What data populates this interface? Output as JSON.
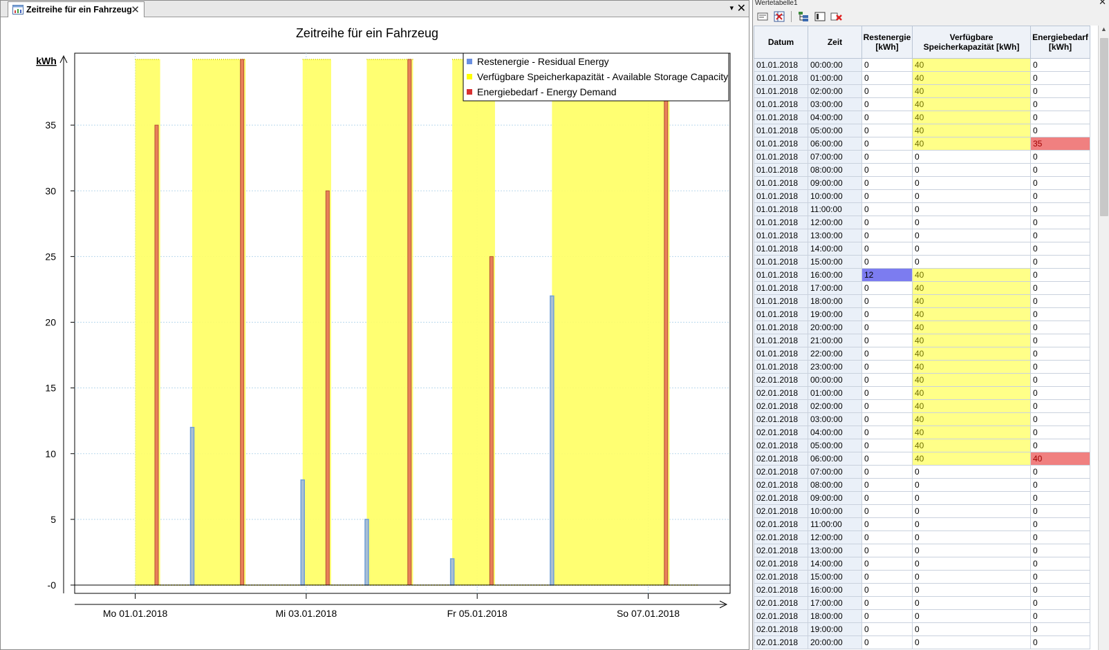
{
  "tab": {
    "label": "Zeitreihe für ein Fahrzeug",
    "close": "✕"
  },
  "pane_controls": {
    "menu": "▾",
    "close": "✕"
  },
  "right_panel": {
    "title": "Wertetabelle1",
    "close": "✕"
  },
  "toolbar_icons": [
    "table-properties-icon",
    "delete-table-icon",
    "export-tree-icon",
    "column-icon",
    "remove-icon"
  ],
  "colors": {
    "residual": "#6f9fd8",
    "storage": "#ffff66",
    "demand": "#e8805a",
    "legend_residual": "#6a8fe0",
    "legend_storage": "#ffff00",
    "legend_demand": "#d83030"
  },
  "chart_data": {
    "type": "bar",
    "title": "Zeitreihe für ein Fahrzeug",
    "ylabel": "kWh",
    "ylim": [
      0,
      40
    ],
    "yticks": [
      {
        "v": 0,
        "label": "-0"
      },
      {
        "v": 5,
        "label": "5"
      },
      {
        "v": 10,
        "label": "10"
      },
      {
        "v": 15,
        "label": "15"
      },
      {
        "v": 20,
        "label": "20"
      },
      {
        "v": 25,
        "label": "25"
      },
      {
        "v": 30,
        "label": "30"
      },
      {
        "v": 35,
        "label": "35"
      }
    ],
    "x_unit": "hours from 01.01.2018 00:00",
    "xlim": [
      -17,
      167
    ],
    "xticks": [
      {
        "v": 0,
        "label": "Mo 01.01.2018"
      },
      {
        "v": 48,
        "label": "Mi 03.01.2018"
      },
      {
        "v": 96,
        "label": "Fr 05.01.2018"
      },
      {
        "v": 144,
        "label": "So 07.01.2018"
      }
    ],
    "legend": [
      {
        "key": "residual",
        "label": "Restenergie - Residual Energy"
      },
      {
        "key": "storage",
        "label": "Verfügbare Speicherkapazität - Available Storage Capacity"
      },
      {
        "key": "demand",
        "label": "Energiebedarf - Energy Demand"
      }
    ],
    "storage_value": 40,
    "storage_ranges": [
      [
        0,
        7
      ],
      [
        16,
        31
      ],
      [
        47,
        55
      ],
      [
        65,
        78
      ],
      [
        89,
        101
      ],
      [
        117,
        150
      ]
    ],
    "residual": [
      {
        "x": 16,
        "y": 12
      },
      {
        "x": 47,
        "y": 8
      },
      {
        "x": 65,
        "y": 5
      },
      {
        "x": 89,
        "y": 2
      },
      {
        "x": 117,
        "y": 22
      }
    ],
    "demand": [
      {
        "x": 6,
        "y": 35
      },
      {
        "x": 30,
        "y": 40
      },
      {
        "x": 54,
        "y": 30
      },
      {
        "x": 77,
        "y": 40
      },
      {
        "x": 100,
        "y": 25
      },
      {
        "x": 149,
        "y": 40
      }
    ]
  },
  "table": {
    "headers": [
      "Datum",
      "Zeit",
      "Restenergie [kWh]",
      "Verfügbare Speicherkapazität [kWh]",
      "Energiebedarf [kWh]"
    ],
    "rows": [
      [
        "01.01.2018",
        "00:00:00",
        "0",
        "40",
        "0"
      ],
      [
        "01.01.2018",
        "01:00:00",
        "0",
        "40",
        "0"
      ],
      [
        "01.01.2018",
        "02:00:00",
        "0",
        "40",
        "0"
      ],
      [
        "01.01.2018",
        "03:00:00",
        "0",
        "40",
        "0"
      ],
      [
        "01.01.2018",
        "04:00:00",
        "0",
        "40",
        "0"
      ],
      [
        "01.01.2018",
        "05:00:00",
        "0",
        "40",
        "0"
      ],
      [
        "01.01.2018",
        "06:00:00",
        "0",
        "40",
        "35"
      ],
      [
        "01.01.2018",
        "07:00:00",
        "0",
        "0",
        "0"
      ],
      [
        "01.01.2018",
        "08:00:00",
        "0",
        "0",
        "0"
      ],
      [
        "01.01.2018",
        "09:00:00",
        "0",
        "0",
        "0"
      ],
      [
        "01.01.2018",
        "10:00:00",
        "0",
        "0",
        "0"
      ],
      [
        "01.01.2018",
        "11:00:00",
        "0",
        "0",
        "0"
      ],
      [
        "01.01.2018",
        "12:00:00",
        "0",
        "0",
        "0"
      ],
      [
        "01.01.2018",
        "13:00:00",
        "0",
        "0",
        "0"
      ],
      [
        "01.01.2018",
        "14:00:00",
        "0",
        "0",
        "0"
      ],
      [
        "01.01.2018",
        "15:00:00",
        "0",
        "0",
        "0"
      ],
      [
        "01.01.2018",
        "16:00:00",
        "12",
        "40",
        "0"
      ],
      [
        "01.01.2018",
        "17:00:00",
        "0",
        "40",
        "0"
      ],
      [
        "01.01.2018",
        "18:00:00",
        "0",
        "40",
        "0"
      ],
      [
        "01.01.2018",
        "19:00:00",
        "0",
        "40",
        "0"
      ],
      [
        "01.01.2018",
        "20:00:00",
        "0",
        "40",
        "0"
      ],
      [
        "01.01.2018",
        "21:00:00",
        "0",
        "40",
        "0"
      ],
      [
        "01.01.2018",
        "22:00:00",
        "0",
        "40",
        "0"
      ],
      [
        "01.01.2018",
        "23:00:00",
        "0",
        "40",
        "0"
      ],
      [
        "02.01.2018",
        "00:00:00",
        "0",
        "40",
        "0"
      ],
      [
        "02.01.2018",
        "01:00:00",
        "0",
        "40",
        "0"
      ],
      [
        "02.01.2018",
        "02:00:00",
        "0",
        "40",
        "0"
      ],
      [
        "02.01.2018",
        "03:00:00",
        "0",
        "40",
        "0"
      ],
      [
        "02.01.2018",
        "04:00:00",
        "0",
        "40",
        "0"
      ],
      [
        "02.01.2018",
        "05:00:00",
        "0",
        "40",
        "0"
      ],
      [
        "02.01.2018",
        "06:00:00",
        "0",
        "40",
        "40"
      ],
      [
        "02.01.2018",
        "07:00:00",
        "0",
        "0",
        "0"
      ],
      [
        "02.01.2018",
        "08:00:00",
        "0",
        "0",
        "0"
      ],
      [
        "02.01.2018",
        "09:00:00",
        "0",
        "0",
        "0"
      ],
      [
        "02.01.2018",
        "10:00:00",
        "0",
        "0",
        "0"
      ],
      [
        "02.01.2018",
        "11:00:00",
        "0",
        "0",
        "0"
      ],
      [
        "02.01.2018",
        "12:00:00",
        "0",
        "0",
        "0"
      ],
      [
        "02.01.2018",
        "13:00:00",
        "0",
        "0",
        "0"
      ],
      [
        "02.01.2018",
        "14:00:00",
        "0",
        "0",
        "0"
      ],
      [
        "02.01.2018",
        "15:00:00",
        "0",
        "0",
        "0"
      ],
      [
        "02.01.2018",
        "16:00:00",
        "0",
        "0",
        "0"
      ],
      [
        "02.01.2018",
        "17:00:00",
        "0",
        "0",
        "0"
      ],
      [
        "02.01.2018",
        "18:00:00",
        "0",
        "0",
        "0"
      ],
      [
        "02.01.2018",
        "19:00:00",
        "0",
        "0",
        "0"
      ],
      [
        "02.01.2018",
        "20:00:00",
        "0",
        "0",
        "0"
      ]
    ]
  }
}
